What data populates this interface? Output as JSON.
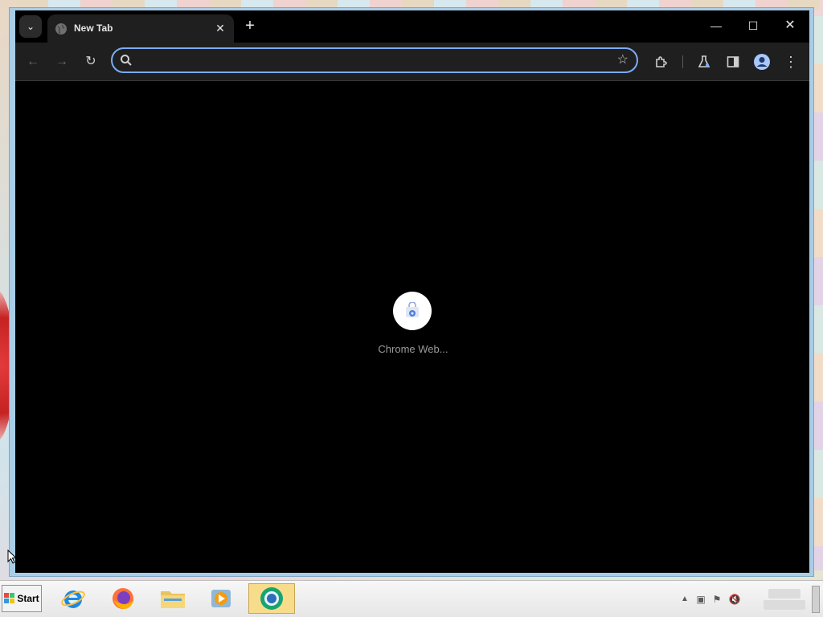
{
  "tabstrip": {
    "tab_search_glyph": "⌄",
    "tab": {
      "title": "New Tab",
      "close_glyph": "✕"
    },
    "new_tab_glyph": "+",
    "window_controls": {
      "minimize": "—",
      "maximize": "☐",
      "close": "✕"
    }
  },
  "toolbar": {
    "back_glyph": "←",
    "forward_glyph": "→",
    "reload_glyph": "↻",
    "omnibox": {
      "value": "",
      "placeholder": ""
    },
    "bookmark_glyph": "☆",
    "extensions_icon": "puzzle-icon",
    "labs_icon": "flask-icon",
    "side_panel_icon": "side-panel-icon",
    "profile_icon": "profile-icon",
    "menu_glyph": "⋮",
    "accent": "#7cacf8"
  },
  "content": {
    "loading_label": "Chrome Web...",
    "loading_icon": "chrome-web-store-icon"
  },
  "taskbar": {
    "start_label": "Start",
    "apps": [
      {
        "name": "Internet Explorer",
        "icon": "ie-icon",
        "active": false
      },
      {
        "name": "Firefox",
        "icon": "firefox-icon",
        "active": false
      },
      {
        "name": "File Explorer",
        "icon": "folder-icon",
        "active": false
      },
      {
        "name": "Media Player",
        "icon": "media-player-icon",
        "active": false
      },
      {
        "name": "Chrome",
        "icon": "chrome-icon",
        "active": true
      }
    ],
    "tray": {
      "up_glyph": "▲",
      "net_glyph": "▣",
      "flag_glyph": "⚑",
      "volume_glyph": "🔇"
    }
  }
}
